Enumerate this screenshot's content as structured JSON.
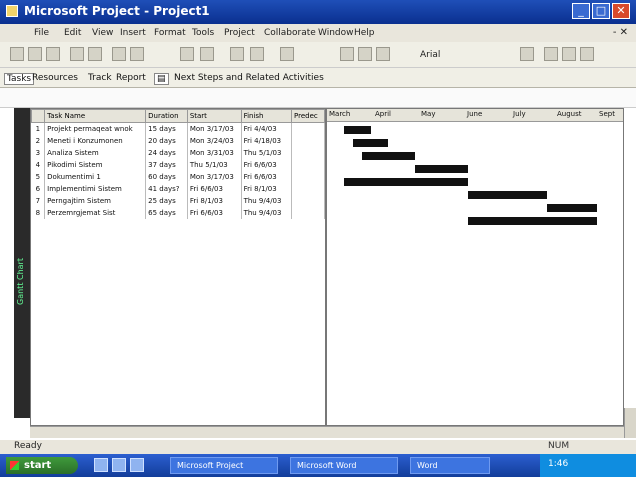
{
  "window": {
    "title": "Microsoft Project - Project1",
    "buttons": {
      "minimize": "_",
      "maximize": "□",
      "close": "✕"
    }
  },
  "menu": [
    {
      "label": "File"
    },
    {
      "label": "Edit"
    },
    {
      "label": "View"
    },
    {
      "label": "Insert"
    },
    {
      "label": "Format"
    },
    {
      "label": "Tools"
    },
    {
      "label": "Project"
    },
    {
      "label": "Collaborate"
    },
    {
      "label": "Window"
    },
    {
      "label": "Help"
    }
  ],
  "toolbar": {
    "font_size": "Arial"
  },
  "guide": {
    "tasks": "Tasks",
    "resources": "Resources",
    "track": "Track",
    "report": "Report",
    "next_steps": "Next Steps and Related Activities"
  },
  "grid": {
    "columns": [
      "Task Name",
      "Duration",
      "Start",
      "Finish",
      "Predec"
    ],
    "rows": [
      {
        "id": "1",
        "name": "Projekt permaqeat wnok",
        "duration": "15 days",
        "start": "Mon 3/17/03",
        "finish": "Fri 4/4/03",
        "pred": ""
      },
      {
        "id": "2",
        "name": "Meneti i Konzumonen",
        "duration": "20 days",
        "start": "Mon 3/24/03",
        "finish": "Fri 4/18/03",
        "pred": ""
      },
      {
        "id": "3",
        "name": "Analiza Sistem",
        "duration": "24 days",
        "start": "Mon 3/31/03",
        "finish": "Thu 5/1/03",
        "pred": ""
      },
      {
        "id": "4",
        "name": "Pikodimi Sistem",
        "duration": "37 days",
        "start": "Thu 5/1/03",
        "finish": "Fri 6/6/03",
        "pred": ""
      },
      {
        "id": "5",
        "name": "Dokumentimi 1",
        "duration": "60 days",
        "start": "Mon 3/17/03",
        "finish": "Fri 6/6/03",
        "pred": ""
      },
      {
        "id": "6",
        "name": "Implementimi Sistem",
        "duration": "41 days?",
        "start": "Fri 6/6/03",
        "finish": "Fri 8/1/03",
        "pred": ""
      },
      {
        "id": "7",
        "name": "Perngajtim Sistem",
        "duration": "25 days",
        "start": "Fri 8/1/03",
        "finish": "Thu 9/4/03",
        "pred": ""
      },
      {
        "id": "8",
        "name": "Perzemrgjemat Sist",
        "duration": "65 days",
        "start": "Fri 6/6/03",
        "finish": "Thu 9/4/03",
        "pred": ""
      }
    ]
  },
  "gantt": {
    "months": [
      "March",
      "April",
      "May",
      "June",
      "July",
      "August",
      "Sept"
    ],
    "bars": [
      {
        "row": 0,
        "start_month": 0.33,
        "end_month": 0.95
      },
      {
        "row": 1,
        "start_month": 0.55,
        "end_month": 1.35
      },
      {
        "row": 2,
        "start_month": 0.75,
        "end_month": 1.95
      },
      {
        "row": 3,
        "start_month": 1.95,
        "end_month": 3.15
      },
      {
        "row": 4,
        "start_month": 0.33,
        "end_month": 3.15
      },
      {
        "row": 5,
        "start_month": 3.15,
        "end_month": 4.95
      },
      {
        "row": 6,
        "start_month": 4.95,
        "end_month": 6.1
      },
      {
        "row": 7,
        "start_month": 3.15,
        "end_month": 6.1
      }
    ]
  },
  "viewbar_label": "Gantt Chart",
  "status": {
    "ready": "Ready",
    "ovr": "NUM"
  },
  "taskbar": {
    "start": "start",
    "tasks": [
      "Microsoft Project",
      "Microsoft Word",
      "Word"
    ],
    "clock": "1:46"
  }
}
